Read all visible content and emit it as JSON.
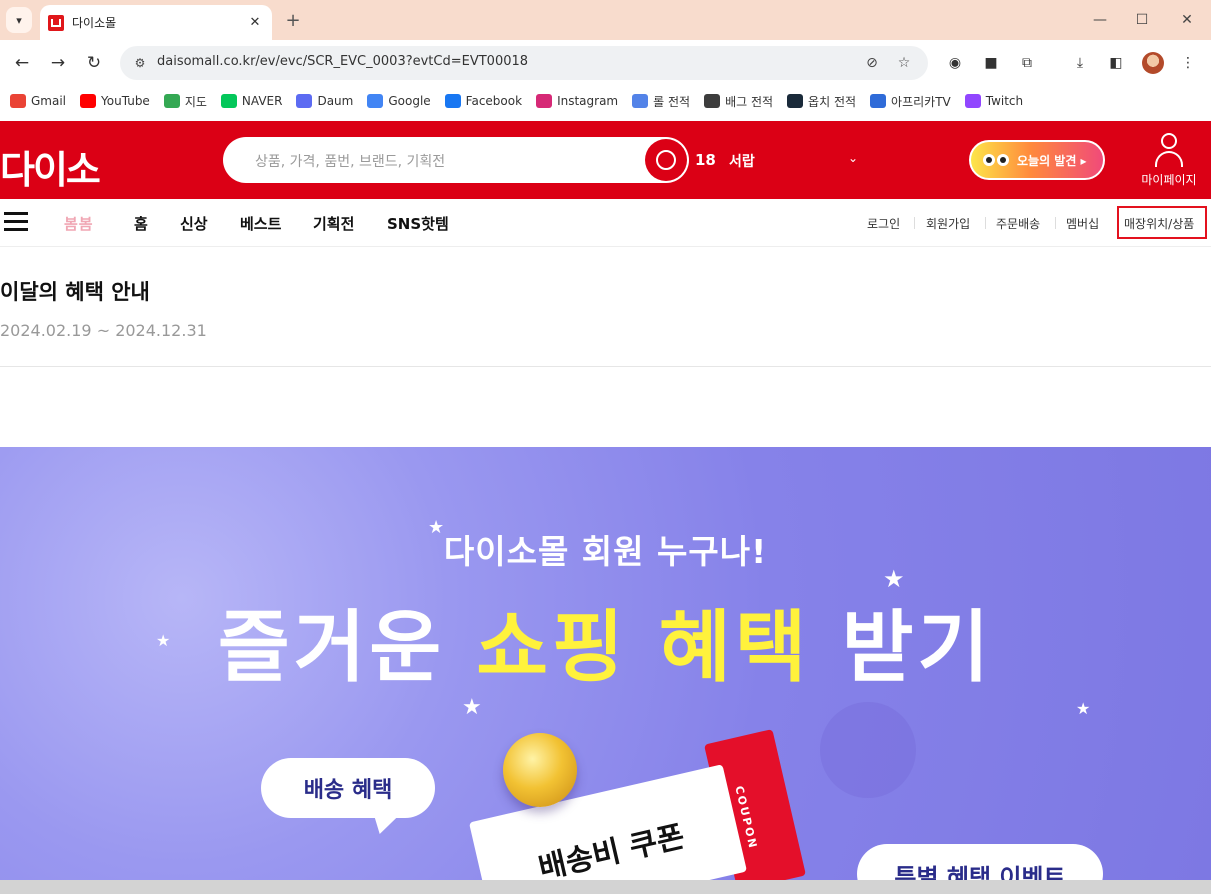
{
  "browser": {
    "tab_title": "다이소몰",
    "url": "daisomall.co.kr/ev/evc/SCR_EVC_0003?evtCd=EVT00018",
    "bookmarks": [
      {
        "label": "Gmail",
        "color": "#ea4335",
        "icon": "gmail-icon"
      },
      {
        "label": "YouTube",
        "color": "#ff0000",
        "icon": "youtube-icon"
      },
      {
        "label": "지도",
        "color": "#34a853",
        "icon": "maps-icon"
      },
      {
        "label": "NAVER",
        "color": "#03c75a",
        "icon": "naver-icon"
      },
      {
        "label": "Daum",
        "color": "#5c6bf2",
        "icon": "daum-icon"
      },
      {
        "label": "Google",
        "color": "#4285f4",
        "icon": "google-icon"
      },
      {
        "label": "Facebook",
        "color": "#1877f2",
        "icon": "facebook-icon"
      },
      {
        "label": "Instagram",
        "color": "#d62976",
        "icon": "instagram-icon"
      },
      {
        "label": "롤 전적",
        "color": "#5383e8",
        "icon": "opgg-icon"
      },
      {
        "label": "배그 전적",
        "color": "#3d3d3d",
        "icon": "pubg-icon"
      },
      {
        "label": "옵치 전적",
        "color": "#1a2a3a",
        "icon": "overwatch-icon"
      },
      {
        "label": "아프리카TV",
        "color": "#2f6bd8",
        "icon": "afreecatv-icon"
      },
      {
        "label": "Twitch",
        "color": "#9146ff",
        "icon": "twitch-icon"
      }
    ]
  },
  "header": {
    "logo": "다이소",
    "search_placeholder": "상품, 가격, 품번, 브랜드, 기획전",
    "rank_number": "18",
    "rank_keyword": "서랍",
    "discover_label": "오늘의 발견 ▸",
    "mypage_label": "마이페이지",
    "brand_color": "#db0015"
  },
  "nav": {
    "bombom": "봄봄",
    "menu": [
      "홈",
      "신상",
      "베스트",
      "기획전",
      "SNS핫템"
    ],
    "utility": [
      "로그인",
      "회원가입",
      "주문배송",
      "멤버십",
      "매장위치/상품"
    ]
  },
  "event": {
    "title": "이달의 혜택 안내",
    "period": "2024.02.19 ~ 2024.12.31"
  },
  "banner": {
    "subtitle": "다이소몰 회원 누구나!",
    "main_white_1": "즐거운",
    "main_yellow": "쇼핑 혜택",
    "main_white_2": "받기",
    "bubble_label": "배송 혜택",
    "coupon_label": "배송비 쿠폰",
    "coupon_tab": "COUPON",
    "special_label": "특별 혜택 이벤트"
  }
}
